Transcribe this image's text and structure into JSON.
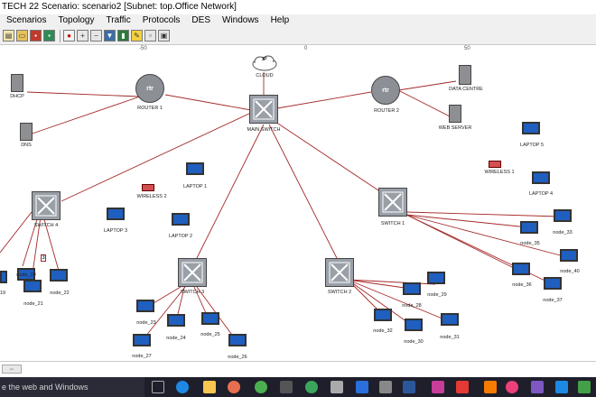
{
  "window": {
    "title": "TECH 22 Scenario: scenario2  [Subnet: top.Office Network]"
  },
  "menu": [
    "Scenarios",
    "Topology",
    "Traffic",
    "Protocols",
    "DES",
    "Windows",
    "Help"
  ],
  "toolbar": {
    "icons": [
      "new-icon",
      "open-icon",
      "save-icon",
      "print-icon",
      "map-icon",
      "zoom-in-icon",
      "zoom-out-icon",
      "flow-icon",
      "device-icon",
      "configure-icon",
      "run-icon",
      "results-icon"
    ]
  },
  "ruler": {
    "ticks": [
      "-50",
      "0",
      "50"
    ]
  },
  "nodes": {
    "cloud": {
      "label": "IP\nCLOUD"
    },
    "dhcp": {
      "label": "DHCP"
    },
    "dns": {
      "label": "DNS"
    },
    "router1": {
      "label": "ROUTER 1"
    },
    "router2": {
      "label": "ROUTER 2"
    },
    "main_switch": {
      "label": "MAIN SWITCH"
    },
    "data_centre": {
      "label": "DATA CENTRE"
    },
    "web_server": {
      "label": "WEB SERVER"
    },
    "laptop5": {
      "label": "LAPTOP 5"
    },
    "wireless1": {
      "label": "WIRELESS 1"
    },
    "laptop4": {
      "label": "LAPTOP 4"
    },
    "laptop1": {
      "label": "LAPTOP 1"
    },
    "wireless2": {
      "label": "WIRELESS 2"
    },
    "laptop2": {
      "label": "LAPTOP 2"
    },
    "laptop3": {
      "label": "LAPTOP 3"
    },
    "switch4": {
      "label": "SWITCH 4"
    },
    "switch1": {
      "label": "SWITCH 1"
    },
    "switch3": {
      "label": "SWITCH 3"
    },
    "switch2": {
      "label": "SWITCH 2"
    },
    "node_19": {
      "label": "19"
    },
    "node_20": {
      "label": "node_20"
    },
    "node_21": {
      "label": "node_21"
    },
    "node_22": {
      "label": "node_22"
    },
    "node_23": {
      "label": "node_23"
    },
    "node_24": {
      "label": "node_24"
    },
    "node_25": {
      "label": "node_25"
    },
    "node_26": {
      "label": "node_26"
    },
    "node_27": {
      "label": "node_27"
    },
    "node_28": {
      "label": "node_28"
    },
    "node_29": {
      "label": "node_29"
    },
    "node_30": {
      "label": "node_30"
    },
    "node_31": {
      "label": "node_31"
    },
    "node_32": {
      "label": "node_32"
    },
    "node_33": {
      "label": "node_33"
    },
    "node_35": {
      "label": "node_35"
    },
    "node_36": {
      "label": "node_36"
    },
    "node_37": {
      "label": "node_37"
    },
    "node_40": {
      "label": "node_40"
    },
    "link_badge": {
      "label": "3"
    }
  },
  "taskbar": {
    "search_text": "e the web and Windows"
  },
  "colors": {
    "link": "#a52a2a",
    "switch_face": "#9aa0a8",
    "router_face": "#8c9096",
    "taskbar": "#1f1f2b"
  }
}
